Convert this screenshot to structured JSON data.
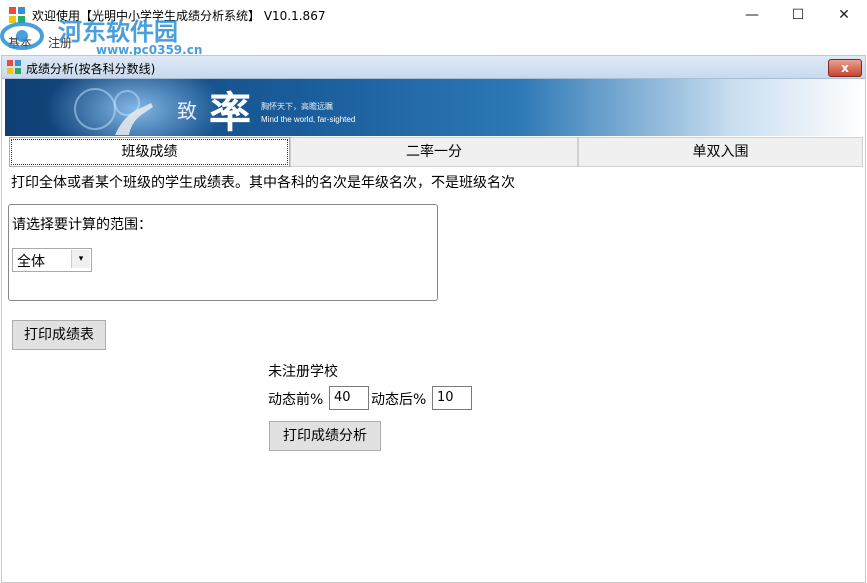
{
  "window": {
    "title": "欢迎使用【光明中小学学生成绩分析系统】 V10.1.867",
    "minimize_glyph": "—",
    "maximize_glyph": "☐",
    "close_glyph": "✕"
  },
  "watermark": {
    "name": "河东软件园",
    "url": "www.pc0359.cn"
  },
  "menu": {
    "items": [
      "基本",
      "注册"
    ]
  },
  "child_window": {
    "title": "成绩分析(按各科分数线)",
    "close_glyph": "x"
  },
  "banner": {
    "char1": "致",
    "char2": "率",
    "tagline_cn": "胸怀天下，高瞻远瞩",
    "tagline_en": "Mind the world, far-sighted"
  },
  "tabs": [
    {
      "label": "班级成绩",
      "active": true
    },
    {
      "label": "二率一分",
      "active": false
    },
    {
      "label": "单双入围",
      "active": false
    }
  ],
  "description": "打印全体或者某个班级的学生成绩表。其中各科的名次是年级名次，不是班级名次",
  "scope": {
    "label": "请选择要计算的范围：",
    "selected": "全体",
    "arrow_glyph": "▾"
  },
  "print_table_button": "打印成绩表",
  "school_label": "未注册学校",
  "dynamic_front": {
    "label": "动态前%",
    "value": "40"
  },
  "dynamic_back": {
    "label": "动态后%",
    "value": "10"
  },
  "print_analysis_button": "打印成绩分析",
  "colors": {
    "accent": "#2a8fd6",
    "close_button": "#c7452f",
    "banner_dark": "#0f3f74"
  }
}
